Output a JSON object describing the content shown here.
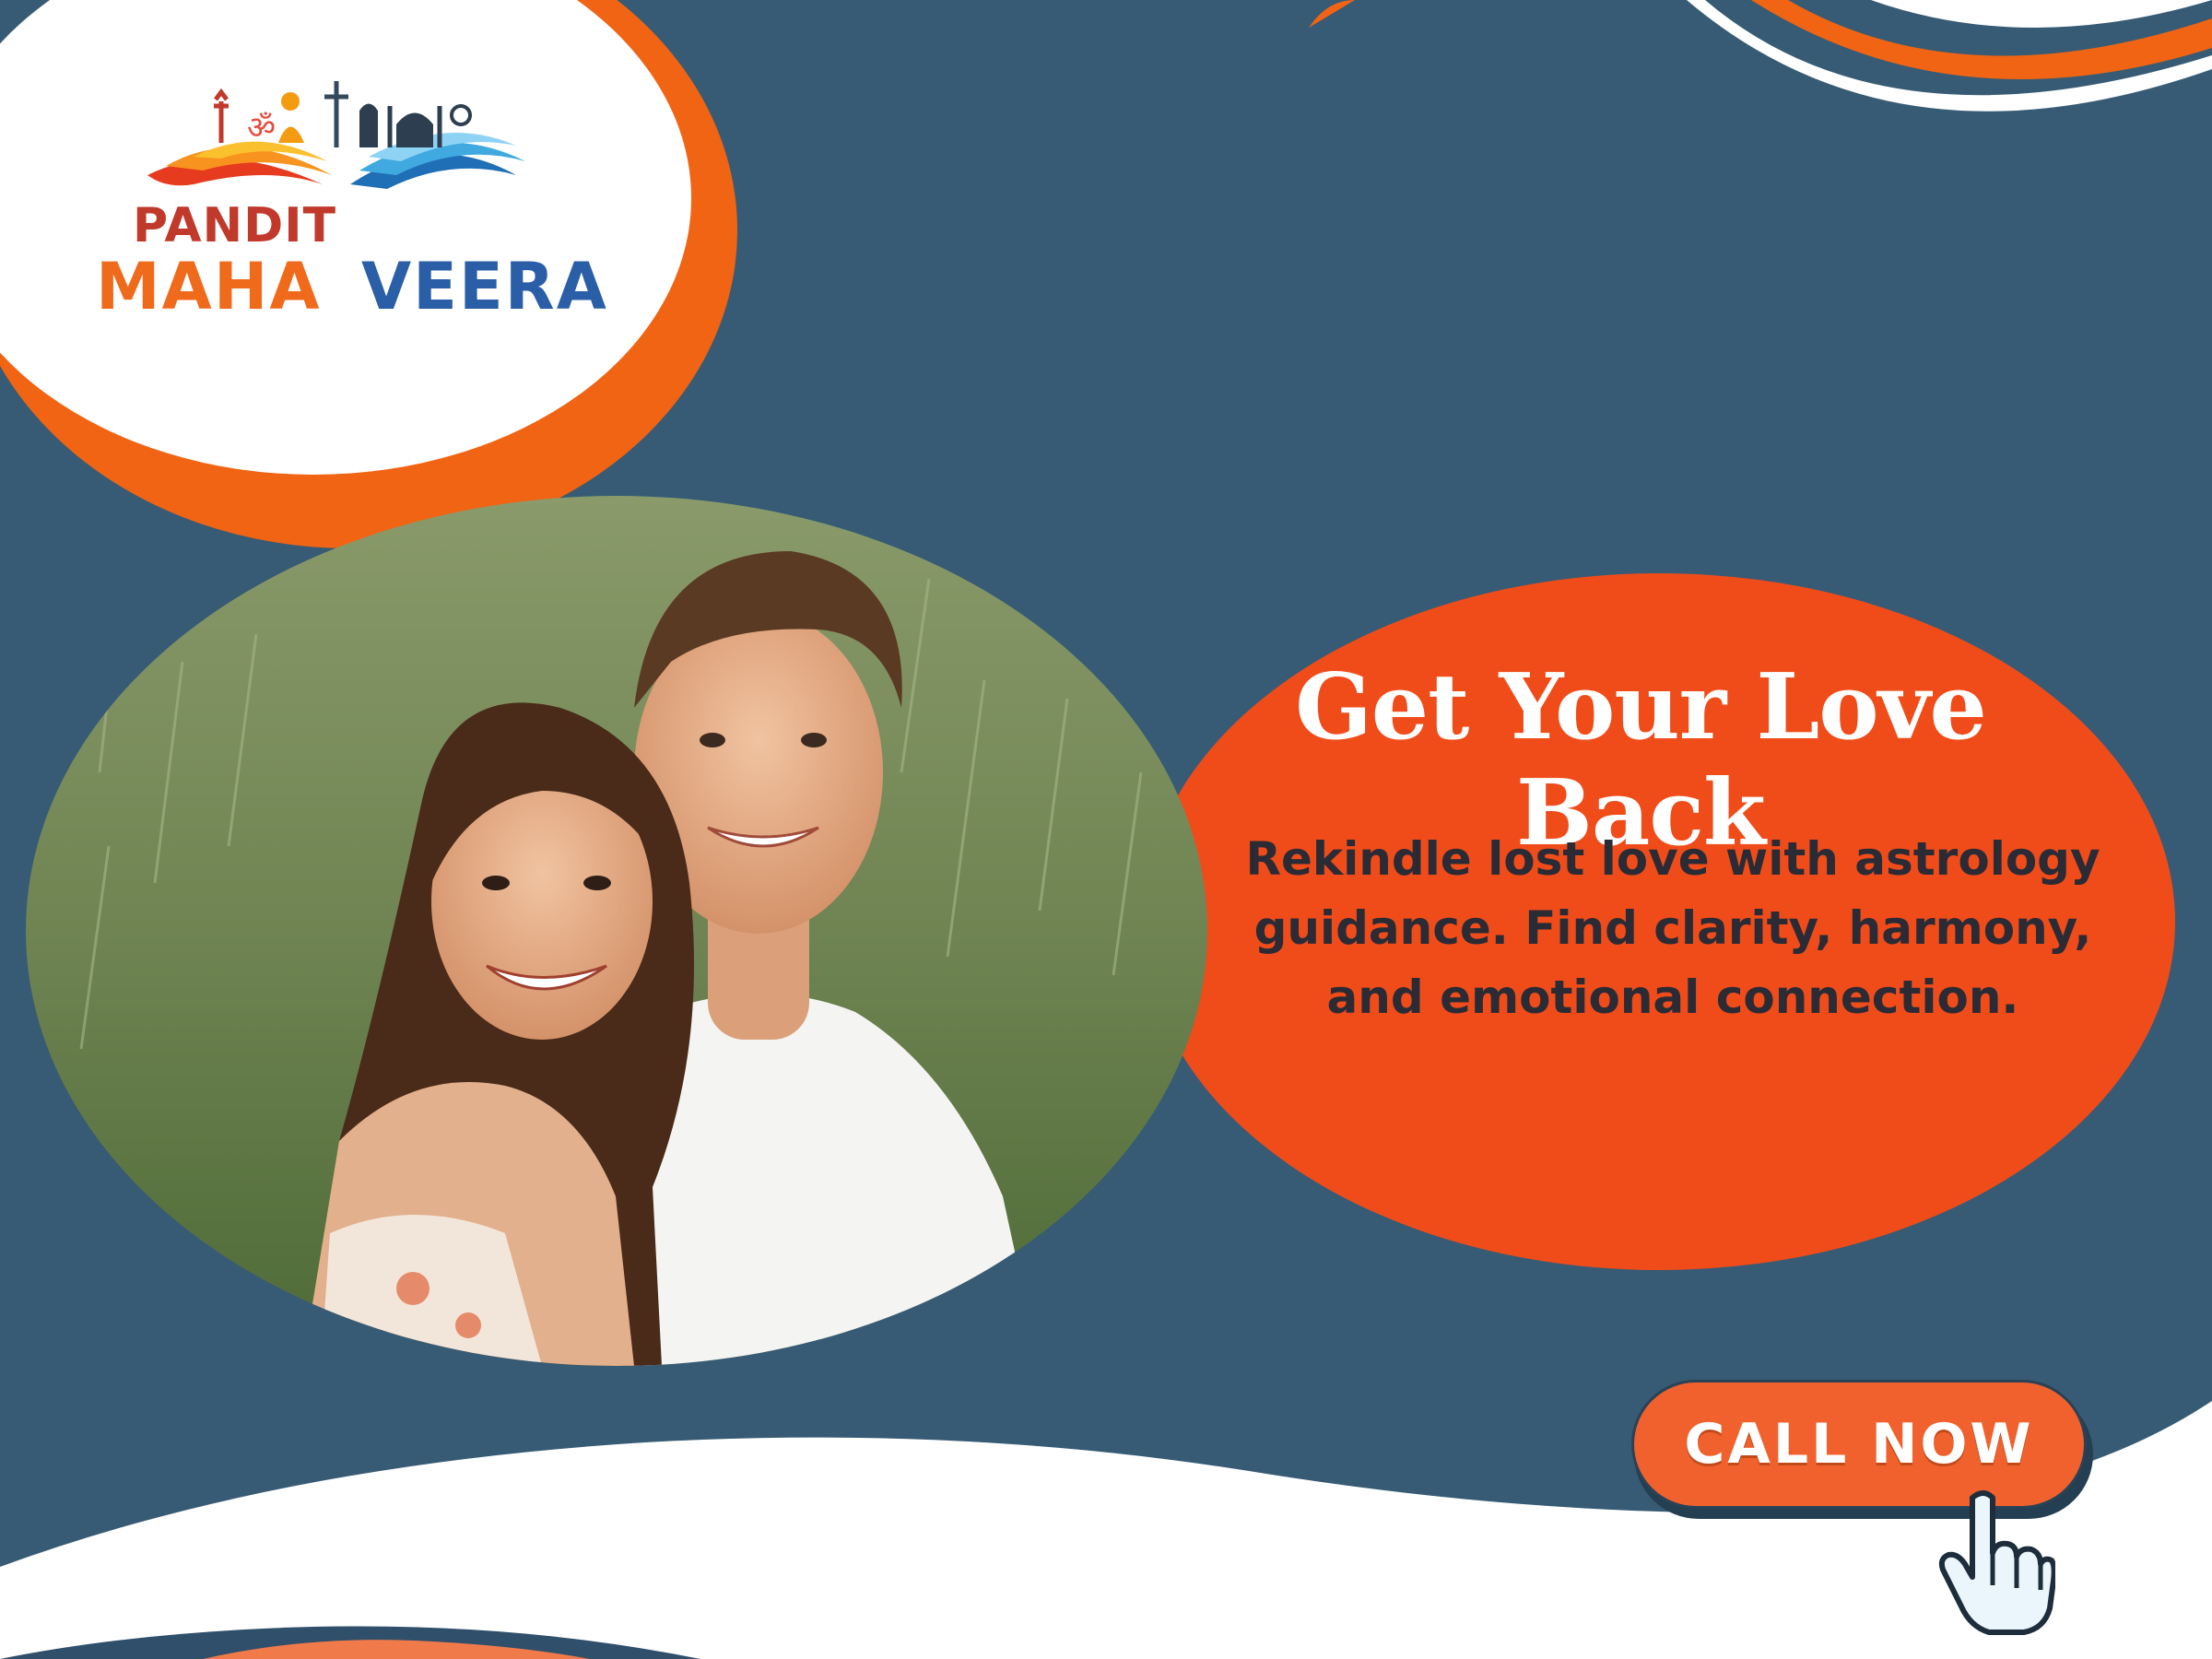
{
  "brand": {
    "line1": "PANDIT",
    "word_left": "MAHA",
    "word_right": "VEERA"
  },
  "hero": {
    "headline": "Get Your Love Back",
    "description": "Rekindle lost love with astrology guidance. Find clarity, harmony, and emotional connection."
  },
  "cta": {
    "label": "CALL NOW"
  },
  "icons": {
    "cursor": "pointing-hand-icon",
    "logo_symbols": "religious-symbols-icon"
  },
  "colors": {
    "background": "#375b74",
    "accent_orange": "#f0612d",
    "headline_text": "#ffffff",
    "body_text": "#2b2b36"
  }
}
